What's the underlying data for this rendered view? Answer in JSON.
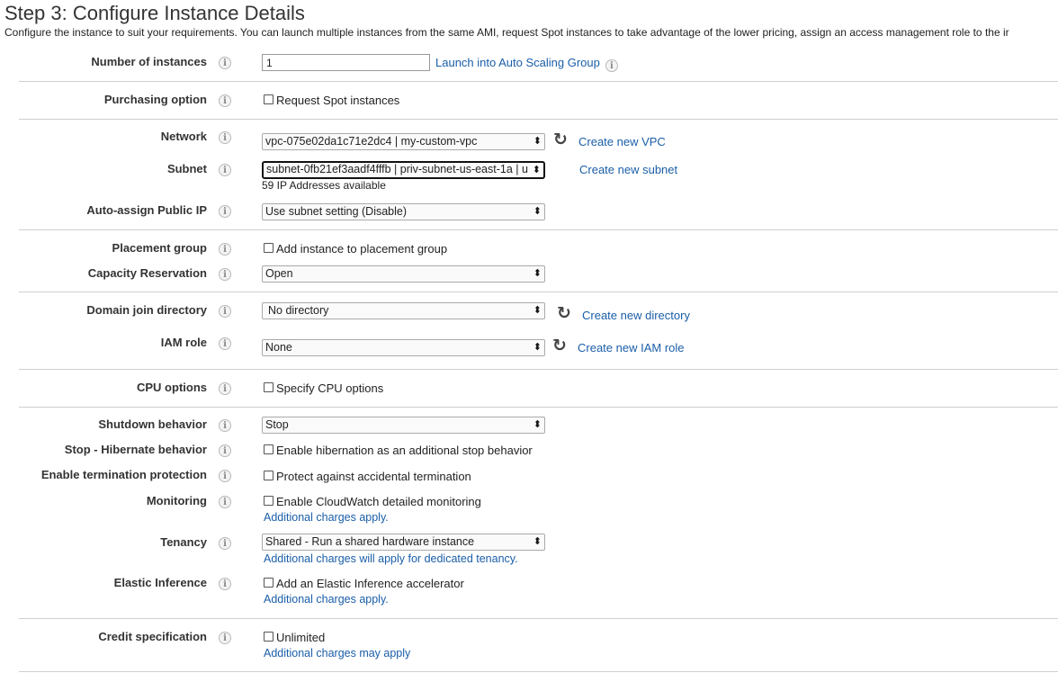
{
  "page": {
    "heading": "Step 3: Configure Instance Details",
    "description": "Configure the instance to suit your requirements. You can launch multiple instances from the same AMI, request Spot instances to take advantage of the lower pricing, assign an access management role to the ir"
  },
  "info_glyph": "i",
  "select_arrow": "⬍",
  "refresh_glyph": "↻",
  "fields": {
    "instances": {
      "label": "Number of instances",
      "value": "1",
      "link": "Launch into Auto Scaling Group"
    },
    "purchasing": {
      "label": "Purchasing option",
      "checkbox": "Request Spot instances"
    },
    "network": {
      "label": "Network",
      "value": "vpc-075e02da1c71e2dc4 | my-custom-vpc",
      "link": "Create new VPC"
    },
    "subnet": {
      "label": "Subnet",
      "value": "subnet-0fb21ef3aadf4fffb | priv-subnet-us-east-1a | u",
      "note": "59 IP Addresses available",
      "link": "Create new subnet"
    },
    "public_ip": {
      "label": "Auto-assign Public IP",
      "value": "Use subnet setting (Disable)"
    },
    "placement": {
      "label": "Placement group",
      "checkbox": "Add instance to placement group"
    },
    "capacity": {
      "label": "Capacity Reservation",
      "value": "Open"
    },
    "domain": {
      "label": "Domain join directory",
      "value": "No directory",
      "link": "Create new directory"
    },
    "iam": {
      "label": "IAM role",
      "value": "None",
      "link": "Create new IAM role"
    },
    "cpu": {
      "label": "CPU options",
      "checkbox": "Specify CPU options"
    },
    "shutdown": {
      "label": "Shutdown behavior",
      "value": "Stop"
    },
    "hibernate": {
      "label": "Stop - Hibernate behavior",
      "checkbox": "Enable hibernation as an additional stop behavior"
    },
    "termination": {
      "label": "Enable termination protection",
      "checkbox": "Protect against accidental termination"
    },
    "monitoring": {
      "label": "Monitoring",
      "checkbox": "Enable CloudWatch detailed monitoring",
      "link": "Additional charges apply."
    },
    "tenancy": {
      "label": "Tenancy",
      "value": "Shared - Run a shared hardware instance",
      "link": "Additional charges will apply for dedicated tenancy."
    },
    "inference": {
      "label": "Elastic Inference",
      "checkbox": "Add an Elastic Inference accelerator",
      "link": "Additional charges apply."
    },
    "credit": {
      "label": "Credit specification",
      "checkbox": "Unlimited",
      "link": "Additional charges may apply"
    }
  },
  "colors": {
    "link": "#1a5ea8",
    "divider": "#cfcfcf"
  }
}
